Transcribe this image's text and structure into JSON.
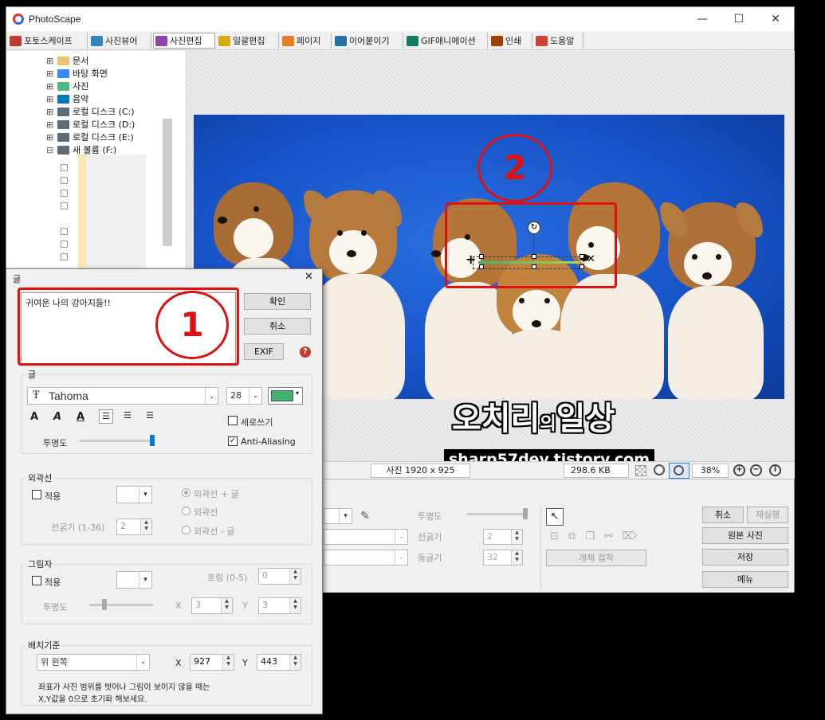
{
  "app": {
    "title": "PhotoScape",
    "minimize": "—",
    "maximize": "☐",
    "close": "✕"
  },
  "tabs": [
    {
      "label": "포토스케이프",
      "color": "#c0392b"
    },
    {
      "label": "사진뷰어",
      "color": "#2e86c1"
    },
    {
      "label": "사진편집",
      "color": "#8e44ad"
    },
    {
      "label": "일괄편집",
      "color": "#d4ac0d"
    },
    {
      "label": "페이지",
      "color": "#e67e22"
    },
    {
      "label": "이어붙이기",
      "color": "#2471a3"
    },
    {
      "label": "GIF애니메이션",
      "color": "#117a65"
    },
    {
      "label": "인쇄",
      "color": "#a04000"
    },
    {
      "label": "도움말",
      "color": "#cb4335"
    }
  ],
  "tree": [
    {
      "label": "문서",
      "expander": "⊞"
    },
    {
      "label": "바탕 화면",
      "expander": "⊞"
    },
    {
      "label": "사진",
      "expander": "⊞"
    },
    {
      "label": "음악",
      "expander": "⊞"
    },
    {
      "label": "로컬 디스크 (C:)",
      "expander": "⊞"
    },
    {
      "label": "로컬 디스크 (D:)",
      "expander": "⊞"
    },
    {
      "label": "로컬 디스크 (E:)",
      "expander": "⊞"
    },
    {
      "label": "새 볼륨 (F:)",
      "expander": "⊟"
    }
  ],
  "statusbar": {
    "photo_size": "사진 1920 x 925",
    "file_size": "298.6 KB",
    "zoom": "38%"
  },
  "watermark": {
    "line1": "오치리",
    "line1_small": "의",
    "line1_end": "일상",
    "line2": "sharp57dev.tistory.com"
  },
  "annotations": {
    "circle1": "1",
    "circle2": "2"
  },
  "bottom_panel": {
    "transparency": "투명도",
    "line_width": "선굵기",
    "line_width_value": "2",
    "roundness": "둥글기",
    "roundness_value": "32",
    "paste_object": "개체 접착",
    "cancel": "취소",
    "redo": "재실행",
    "original_photo": "원본 사진",
    "save": "저장",
    "menu": "메뉴"
  },
  "dialog": {
    "title": "글",
    "close": "✕",
    "text_value": "귀여운 나의 강아지들!!",
    "ok": "확인",
    "cancel": "취소",
    "exif": "EXIF",
    "help": "?",
    "font_group": "글",
    "font_name": "Tahoma",
    "font_size": "28",
    "font_color": "#3cb371",
    "bold": "A",
    "italic": "A",
    "underline": "A",
    "vertical": "세로쓰기",
    "antialias": "Anti-Aliasing",
    "antialias_check": "✓",
    "opacity": "투명도",
    "outline_group": "외곽선",
    "outline_apply": "적용",
    "outline_width": "선굵기 (1-36)",
    "outline_width_value": "2",
    "outline_opt1": "외곽선 + 글",
    "outline_opt2": "외곽선",
    "outline_opt3": "외곽선 - 글",
    "shadow_group": "그림자",
    "shadow_apply": "적용",
    "shadow_blur": "흐림 (0-5)",
    "shadow_blur_value": "0",
    "shadow_opacity": "투명도",
    "shadow_x_label": "X",
    "shadow_x": "3",
    "shadow_y_label": "Y",
    "shadow_y": "3",
    "placement_group": "배치기준",
    "placement_value": "위 왼쪽",
    "pos_x_label": "X",
    "pos_x": "927",
    "pos_y_label": "Y",
    "pos_y": "443",
    "note_line1": "좌표가 사진 범위를 벗어나 그림이 보이지 않을 때는",
    "note_line2": "X,Y값을 0으로 초기화 해보세요."
  }
}
